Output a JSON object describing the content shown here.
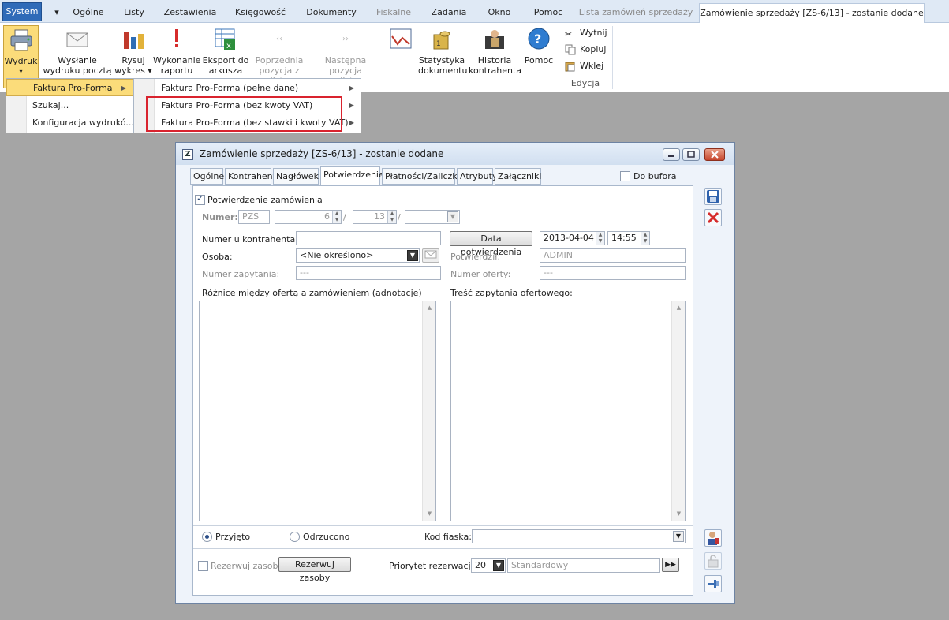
{
  "tabs": {
    "system": "System",
    "ogolne": "Ogólne",
    "listy": "Listy",
    "zestawienia": "Zestawienia",
    "ksiegowosc": "Księgowość",
    "dokumenty": "Dokumenty",
    "fiskalne": "Fiskalne",
    "zadania": "Zadania",
    "okno": "Okno",
    "pomoc": "Pomoc",
    "lista": "Lista zamówień sprzedaży",
    "active": "Zamówienie sprzedaży [ZS-6/13] - zostanie dodane"
  },
  "ribbon": {
    "wydruk": "Wydruk",
    "wyslanie1": "Wysłanie",
    "wyslanie2": "wydruku pocztą ▾",
    "rysuj1": "Rysuj",
    "rysuj2": "wykres ▾",
    "wykonanie1": "Wykonanie",
    "wykonanie2": "raportu",
    "eksport1": "Eksport do",
    "eksport2": "arkusza",
    "poprzednia1": "Poprzednia",
    "poprzednia2": "pozycja z listy",
    "nastepna1": "Następna pozycja",
    "nastepna2": "z listy",
    "statystyka1": "Statystyka",
    "statystyka2": "dokumentu",
    "historia1": "Historia",
    "historia2": "kontrahenta",
    "pomoc": "Pomoc",
    "wytnij": "Wytnij",
    "kopiuj": "Kopiuj",
    "wklej": "Wklej",
    "edycja": "Edycja"
  },
  "menu": {
    "items": [
      "Faktura Pro-Forma",
      "Szukaj...",
      "Konfiguracja wydrukó..."
    ],
    "submenu": [
      "Faktura Pro-Forma (pełne dane)",
      "Faktura Pro-Forma (bez kwoty VAT)",
      "Faktura Pro-Forma (bez stawki i kwoty VAT)"
    ]
  },
  "dialog": {
    "title": "Zamówienie sprzedaży [ZS-6/13] - zostanie dodane",
    "tabs": [
      "Ogólne",
      "Kontrahent",
      "Nagłówek",
      "Potwierdzenie",
      "Płatności/Zaliczki",
      "Atrybuty",
      "Załączniki"
    ],
    "active_tab": "Potwierdzenie",
    "do_bufora": "Do bufora",
    "potwierdzenie": "Potwierdzenie zamówienia",
    "numer_label": "Numer:",
    "numer_prefix": "PZS",
    "numer_value": "6",
    "numer_year": "13",
    "slash": "/",
    "numer_u_kontrahenta": "Numer u kontrahenta:",
    "data_potwierdzenia": "Data potwierdzenia",
    "date": "2013-04-04",
    "time": "14:55",
    "osoba_label": "Osoba:",
    "osoba_value": "<Nie określono>",
    "potwierdzil_label": "Potwierdził:",
    "potwierdzil_value": "ADMIN",
    "numer_zapytania_label": "Numer zapytania:",
    "numer_zapytania_value": "---",
    "numer_oferty_label": "Numer oferty:",
    "numer_oferty_value": "---",
    "roznice_label": "Różnice między ofertą a zamówieniem (adnotacje)",
    "tresc_label": "Treść zapytania ofertowego:",
    "przyjeto": "Przyjęto",
    "odrzucono": "Odrzucono",
    "kod_fiaska": "Kod fiaska:",
    "rezerwuj_zasoby_chk": "Rezerwuj zasoby",
    "rezerwuj_zasoby_btn": "Rezerwuj zasoby",
    "priorytet_label": "Priorytet rezerwacji:",
    "priorytet_value": "20",
    "priorytet_text": "Standardowy"
  }
}
